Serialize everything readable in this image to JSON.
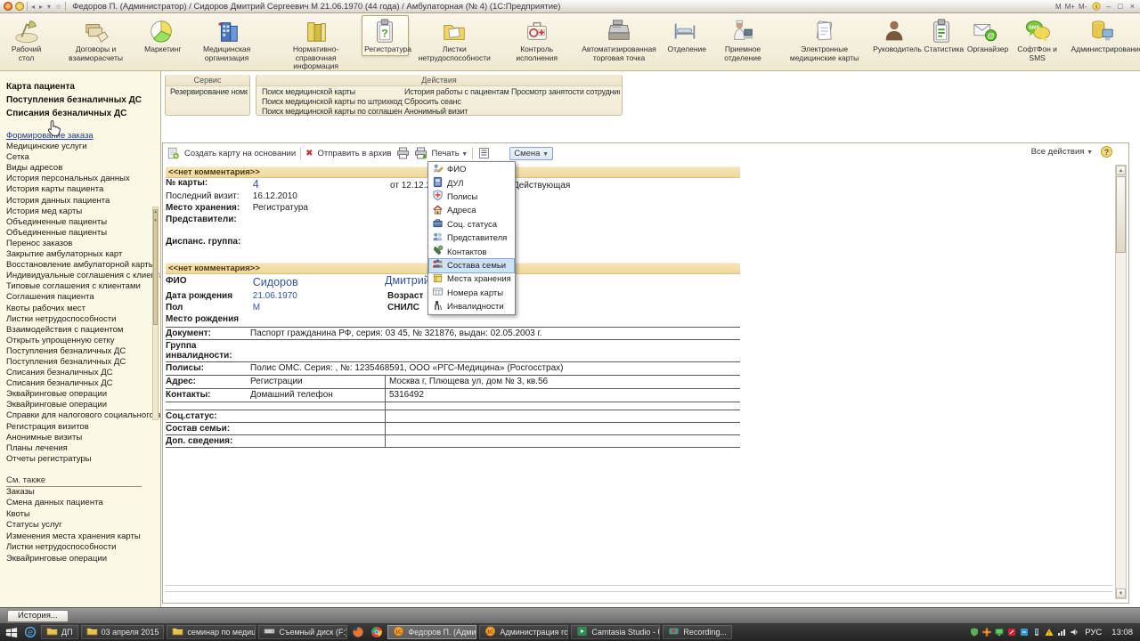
{
  "title_bar": {
    "title": "Федоров П. (Администратор) / Сидоров Дмитрий Сергеевич М 21.06.1970 (44 года) / Амбулаторная (№ 4)   (1С:Предприятие)",
    "mem_buttons": [
      "M",
      "M+",
      "M-"
    ]
  },
  "ribbon": {
    "items": [
      {
        "label": "Рабочий стол",
        "icon": "desk-lamp"
      },
      {
        "label": "Договоры и взаиморасчеты",
        "icon": "contracts"
      },
      {
        "label": "Маркетинг",
        "icon": "pie-chart"
      },
      {
        "label": "Медицинская организация",
        "icon": "clinic-building"
      },
      {
        "label": "Нормативно-справочная информация",
        "icon": "reference-books"
      },
      {
        "label": "Регистратура",
        "icon": "registry-clipboard",
        "selected": true
      },
      {
        "label": "Листки нетрудоспособности",
        "icon": "sick-leave-folder"
      },
      {
        "label": "Контроль исполнения",
        "icon": "control-medkit"
      },
      {
        "label": "Автоматизированная торговая точка",
        "icon": "cash-register"
      },
      {
        "label": "Отделение",
        "icon": "hospital-bed"
      },
      {
        "label": "Приемное отделение",
        "icon": "reception-nurse"
      },
      {
        "label": "Электронные медицинские карты",
        "icon": "med-cards"
      },
      {
        "label": "Руководитель",
        "icon": "manager-person"
      },
      {
        "label": "Статистика",
        "icon": "statistics-clipboard"
      },
      {
        "label": "Органайзер",
        "icon": "organizer-mail"
      },
      {
        "label": "СофтФон и SMS",
        "icon": "softphone-sms"
      },
      {
        "label": "Администрирование",
        "icon": "admin-database"
      }
    ]
  },
  "panel": {
    "service": {
      "title": "Сервис",
      "items": [
        "Резервирование номеров"
      ]
    },
    "actions": {
      "title": "Действия",
      "columns": [
        [
          "Поиск медицинской карты",
          "Поиск медицинской карты по штрихкоду",
          "Поиск медицинской карты по соглашению"
        ],
        [
          "История работы с пациентами",
          "Сбросить сеанс",
          "Анонимный визит"
        ],
        [
          "Просмотр занятости сотрудников"
        ]
      ]
    }
  },
  "sidebar": {
    "primary": [
      "Карта пациента",
      "Поступления безналичных ДС",
      "Списания безналичных ДС"
    ],
    "items": [
      "Формирование заказа",
      "Медицинские услуги",
      "Сетка",
      "Виды адресов",
      "История персональных данных",
      "История карты пациента",
      "История данных пациента",
      "История мед карты",
      "Объединенные пациенты",
      "Объединенные пациенты",
      "Перенос заказов",
      "Закрытие амбулаторных карт",
      "Восстановление амбулаторной карты",
      "Индивидуальные соглашения с клиентами",
      "Типовые соглашения с клиентами",
      "Соглашения пациента",
      "Квоты рабочих мест",
      "Листки нетрудоспособности",
      "Взаимодействия с пациентом",
      "Открыть упрощенную сетку",
      "Поступления безналичных ДС",
      "Поступления безналичных ДС",
      "Списания безналичных ДС",
      "Списания безналичных ДС",
      "Эквайринговые операции",
      "Эквайринговые операции",
      "Справки для налогового социального вы...",
      "Регистрация визитов",
      "Анонимные визиты",
      "Планы лечения",
      "Отчеты регистратуры"
    ],
    "hovered_index": 0,
    "see_also_title": "См. также",
    "see_also": [
      "Заказы",
      "Смена данных пациента",
      "Квоты",
      "Статусы услуг",
      "Изменения места хранения карты",
      "Листки нетрудоспособности",
      "Эквайринговые операции"
    ]
  },
  "toolbar": {
    "create": "Создать карту на основании",
    "archive": "Отправить в архив",
    "print": "Печать",
    "shift": "Смена",
    "all_actions": "Все действия",
    "help": "?"
  },
  "dropdown": {
    "items": [
      {
        "label": "ФИО",
        "icon": "person-edit"
      },
      {
        "label": "ДУЛ",
        "icon": "id-document"
      },
      {
        "label": "Полисы",
        "icon": "polis-shield"
      },
      {
        "label": "Адреса",
        "icon": "address-house"
      },
      {
        "label": "Соц. статуса",
        "icon": "social-briefcase"
      },
      {
        "label": "Представителя",
        "icon": "representative-people"
      },
      {
        "label": "Контактов",
        "icon": "contacts-phone"
      },
      {
        "label": "Состава семьи",
        "icon": "family-group",
        "selected": true
      },
      {
        "label": "Места хранения",
        "icon": "storage-box"
      },
      {
        "label": "Номера карты",
        "icon": "card-number-grid"
      },
      {
        "label": "Инвалидности",
        "icon": "disability-person"
      }
    ]
  },
  "card": {
    "comment": "<<нет комментария>>",
    "number_label": "№ карты:",
    "number": "4",
    "date_text": "от 12.12.2010",
    "status": "Действующая",
    "last_visit_label": "Последний визит:",
    "last_visit": "16.12.2010",
    "storage_label": "Место хранения:",
    "storage": "Регистратура",
    "representatives_label": "Представители:",
    "dispensary_label": "Диспанс. группа:"
  },
  "patient": {
    "comment": "<<нет комментария>>",
    "fio_label": "ФИО",
    "last_name": "Сидоров",
    "first_middle": "Дмитрий Сергеевич",
    "birth_label": "Дата рождения",
    "birth_date": "21.06.1970",
    "age_label": "Возраст",
    "sex_label": "Пол",
    "sex": "М",
    "snils_label": "СНИЛС",
    "birthplace_label": "Место рождения",
    "doc_label": "Документ:",
    "doc_value": "Паспорт гражданина РФ, серия: 03 45, № 321876, выдан: 02.05.2003 г.",
    "disability_label": "Группа инвалидности:",
    "polis_label": "Полисы:",
    "polis_value": "Полис ОМС. Серия: , №: 1235468591, ООО «РГС-Медицина» (Росгосстрах)",
    "address_label": "Адрес:",
    "address_type": "Регистрации",
    "address_value": "Москва г, Плющева ул, дом № 3, кв.56",
    "contacts_label": "Контакты:",
    "contact_type": "Домашний телефон",
    "contact_value": "5316492",
    "social_label": "Соц.статус:",
    "family_label": "Состав семьи:",
    "extra_label": "Доп. сведения:"
  },
  "status_bar": {
    "history_button": "История..."
  },
  "taskbar": {
    "buttons_left": [
      {
        "label": "ДП",
        "icon": "folder"
      },
      {
        "label": "03 апреля 2015",
        "icon": "folder"
      },
      {
        "label": "семинар по медици...",
        "icon": "folder"
      },
      {
        "label": "Съемный диск (F:)",
        "icon": "drive"
      }
    ],
    "buttons_right": [
      {
        "label": "Федоров П. (Админи...",
        "icon": "onec",
        "active": true
      },
      {
        "label": "Администрация гор...",
        "icon": "onec"
      },
      {
        "label": "Camtasia Studio - U...",
        "icon": "camtasia"
      },
      {
        "label": "Recording...",
        "icon": "recorder"
      }
    ],
    "tray_icons": [
      "shield-icon",
      "flower-icon",
      "monitor-icon",
      "pen-icon",
      "blue-app-icon",
      "phone-icon",
      "warning-icon",
      "network-icon",
      "volume-icon"
    ],
    "lang": "РУС",
    "time": "13:08"
  },
  "colors": {
    "link": "#35549c",
    "section_header_bg": "#f2dca6",
    "sidebar_bg": "#fcf8e6",
    "ribbon_bg": "#f4efdd",
    "menu_highlight": "#cfe3f7",
    "taskbar_bg": "#2e2e2e"
  }
}
